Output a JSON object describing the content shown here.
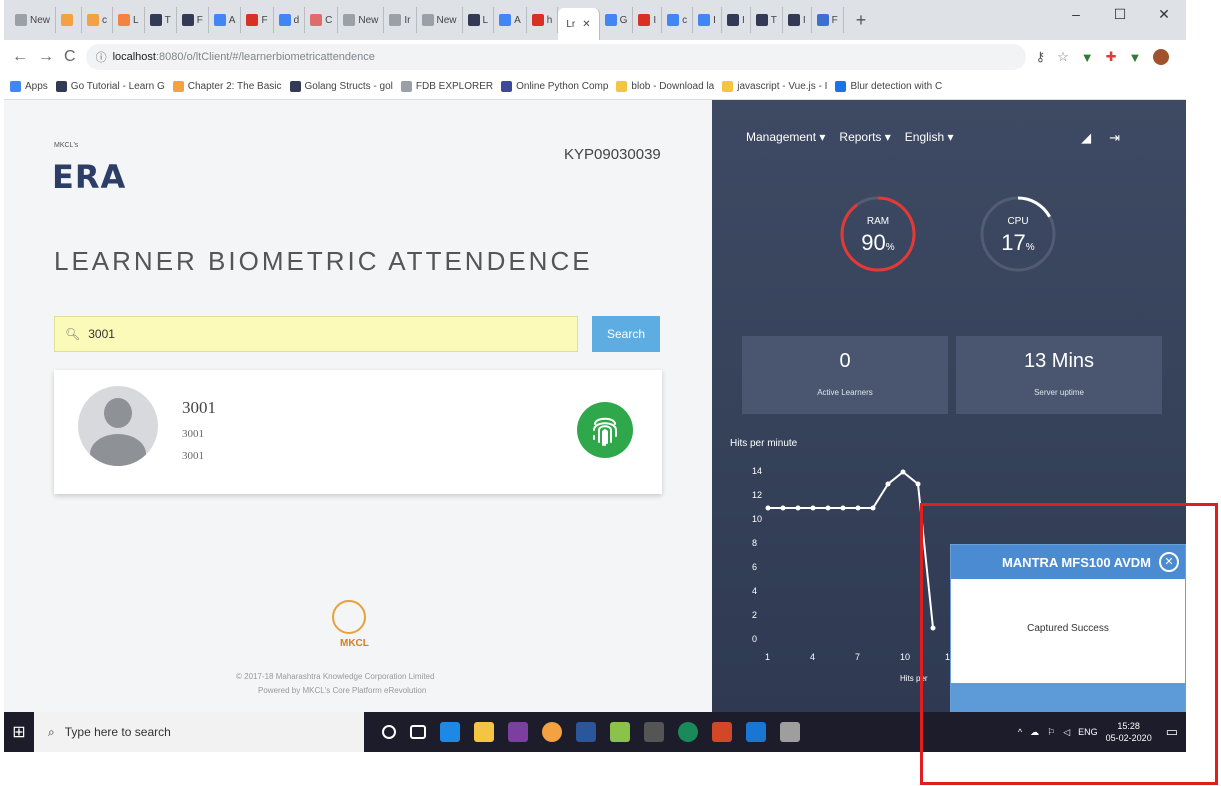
{
  "browser": {
    "tabs": [
      {
        "label": "New",
        "color": "#9aa0a6"
      },
      {
        "label": "",
        "color": "#f4a142"
      },
      {
        "label": "c",
        "color": "#f4a142"
      },
      {
        "label": "L",
        "color": "#f48242"
      },
      {
        "label": "T",
        "color": "#333a55"
      },
      {
        "label": "F",
        "color": "#333a55"
      },
      {
        "label": "A",
        "color": "#4285f4"
      },
      {
        "label": "F",
        "color": "#d93025"
      },
      {
        "label": "d",
        "color": "#4285f4"
      },
      {
        "label": "C",
        "color": "#e06b6b"
      },
      {
        "label": "New",
        "color": "#9aa0a6"
      },
      {
        "label": "Ir",
        "color": "#9aa0a6"
      },
      {
        "label": "New",
        "color": "#9aa0a6"
      },
      {
        "label": "L",
        "color": "#333a55"
      },
      {
        "label": "A",
        "color": "#4285f4"
      },
      {
        "label": "h",
        "color": "#d93025"
      }
    ],
    "active_tab": {
      "label": "Lr"
    },
    "tabs_after": [
      {
        "label": "G",
        "color": "#4285f4"
      },
      {
        "label": "I",
        "color": "#d93025"
      },
      {
        "label": "c",
        "color": "#4285f4"
      },
      {
        "label": "I",
        "color": "#4285f4"
      },
      {
        "label": "I",
        "color": "#333a55"
      },
      {
        "label": "T",
        "color": "#333a55"
      },
      {
        "label": "I",
        "color": "#333a55"
      },
      {
        "label": "F",
        "color": "#3d6fd1"
      }
    ],
    "new_tab": "+",
    "minimize": "–",
    "maximize": "☐",
    "close": "✕",
    "url_host": "localhost",
    "url_path": ":8080/o/ltClient/#/learnerbiometricattendence",
    "bookmarks": [
      {
        "label": "Apps",
        "color": "#4285f4"
      },
      {
        "label": "Go Tutorial - Learn G",
        "color": "#333a55"
      },
      {
        "label": "Chapter 2: The Basic",
        "color": "#f4a142"
      },
      {
        "label": "Golang Structs - gol",
        "color": "#333a55"
      },
      {
        "label": "FDB EXPLORER",
        "color": "#9aa0a6"
      },
      {
        "label": "Online Python Comp",
        "color": "#3d4a99"
      },
      {
        "label": "blob - Download la",
        "color": "#f4c542"
      },
      {
        "label": "javascript - Vue.js - I",
        "color": "#f4c542"
      },
      {
        "label": "Blur detection with C",
        "color": "#1a73e8"
      }
    ]
  },
  "app": {
    "logo_small": "MKCL's",
    "logo_main": "ERA",
    "center_code": "KYP09030039",
    "page_title": "LEARNER BIOMETRIC ATTENDENCE",
    "search_value": "3001",
    "search_button": "Search",
    "learner": {
      "name": "3001",
      "line2": "3001",
      "line3": "3001"
    },
    "footer_brand": "MKCL",
    "footer_line1": "© 2017-18 Maharashtra Knowledge Corporation Limited",
    "footer_line2": "Powered by MKCL's Core Platform eRevolution"
  },
  "dashboard": {
    "menu": [
      "Management ▾",
      "Reports ▾",
      "English ▾"
    ],
    "ram": {
      "label": "RAM",
      "value": "90",
      "unit": "%",
      "fraction": 0.9
    },
    "cpu": {
      "label": "CPU",
      "value": "17",
      "unit": "%",
      "fraction": 0.17
    },
    "active_learners": {
      "value": "0",
      "label": "Active Learners"
    },
    "uptime": {
      "value": "13 Mins",
      "label": "Server uptime"
    },
    "hits_title": "Hits per minute",
    "hits_axis_label": "Hits per"
  },
  "chart_data": {
    "type": "line",
    "title": "Hits per minute",
    "x": [
      1,
      2,
      3,
      4,
      5,
      6,
      7,
      8,
      9,
      10,
      11,
      12
    ],
    "y": [
      11,
      11,
      11,
      11,
      11,
      11,
      11,
      11,
      13,
      14,
      13,
      1
    ],
    "xticks": [
      "1",
      "4",
      "7",
      "10",
      "13"
    ],
    "yticks": [
      "0",
      "2",
      "4",
      "6",
      "8",
      "10",
      "12",
      "14"
    ],
    "ylim": [
      0,
      14
    ],
    "xlim": [
      1,
      13
    ]
  },
  "popup": {
    "title": "MANTRA MFS100 AVDM",
    "message": "Captured Success"
  },
  "taskbar": {
    "search_placeholder": "Type here to search",
    "lang": "ENG",
    "time": "15:28",
    "date": "05-02-2020"
  },
  "colors": {
    "ram_ring": "#e53935",
    "cpu_ring": "#ffffff",
    "highlight": "#e01e1e",
    "fingerprint_button": "#2ea84a"
  }
}
